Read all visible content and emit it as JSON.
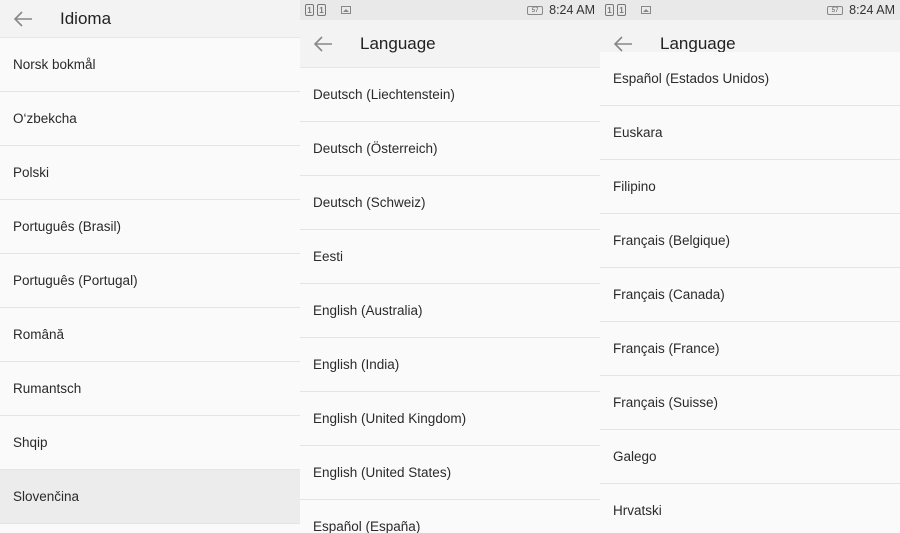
{
  "status": {
    "sim1": "1",
    "sim2": "1",
    "battery": "57",
    "time": "8:24 AM"
  },
  "panel1": {
    "title": "Idioma",
    "items": [
      "Norsk bokmål",
      "O‘zbekcha",
      "Polski",
      "Português (Brasil)",
      "Português (Portugal)",
      "Română",
      "Rumantsch",
      "Shqip",
      "Slovenčina"
    ]
  },
  "panel2": {
    "title": "Language",
    "items": [
      "Deutsch (Liechtenstein)",
      "Deutsch (Österreich)",
      "Deutsch (Schweiz)",
      "Eesti",
      "English (Australia)",
      "English (India)",
      "English (United Kingdom)",
      "English (United States)",
      "Español (España)"
    ]
  },
  "panel3": {
    "title": "Language",
    "items": [
      "Español (Estados Unidos)",
      "Euskara",
      "Filipino",
      "Français (Belgique)",
      "Français (Canada)",
      "Français (France)",
      "Français (Suisse)",
      "Galego",
      "Hrvatski"
    ]
  }
}
